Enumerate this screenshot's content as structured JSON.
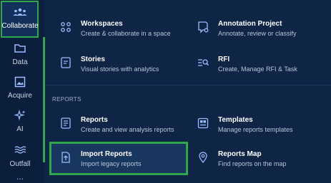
{
  "rail": {
    "items": [
      {
        "label": "Collaborate",
        "icon": "collaborate-icon"
      },
      {
        "label": "Data",
        "icon": "folder-icon"
      },
      {
        "label": "Acquire",
        "icon": "image-icon"
      },
      {
        "label": "AI",
        "icon": "sparkle-icon"
      },
      {
        "label": "Outfall",
        "icon": "waves-icon"
      }
    ],
    "more": "..."
  },
  "panel": {
    "cards": [
      {
        "title": "Workspaces",
        "subtitle": "Create & collaborate in a space",
        "icon": "workspaces-icon"
      },
      {
        "title": "Annotation Project",
        "subtitle": "Annotate, review or classify",
        "icon": "annotation-icon"
      },
      {
        "title": "Stories",
        "subtitle": "Visual stories with analytics",
        "icon": "stories-icon"
      },
      {
        "title": "RFI",
        "subtitle": "Create, Manage RFI & Task",
        "icon": "rfi-icon"
      }
    ],
    "reports_section": "REPORTS",
    "report_cards": [
      {
        "title": "Reports",
        "subtitle": "Create and view analysis reports",
        "icon": "reports-icon"
      },
      {
        "title": "Templates",
        "subtitle": "Manage reports templates",
        "icon": "templates-icon"
      },
      {
        "title": "Import Reports",
        "subtitle": "Import legacy reports",
        "icon": "import-reports-icon"
      },
      {
        "title": "Reports Map",
        "subtitle": "Find reports on the map",
        "icon": "map-pin-icon"
      }
    ]
  },
  "colors": {
    "highlight": "#2ea84a",
    "panel_bg": "#0e2546",
    "rail_bg": "#0b1e3c",
    "icon": "#8fb4ff"
  }
}
